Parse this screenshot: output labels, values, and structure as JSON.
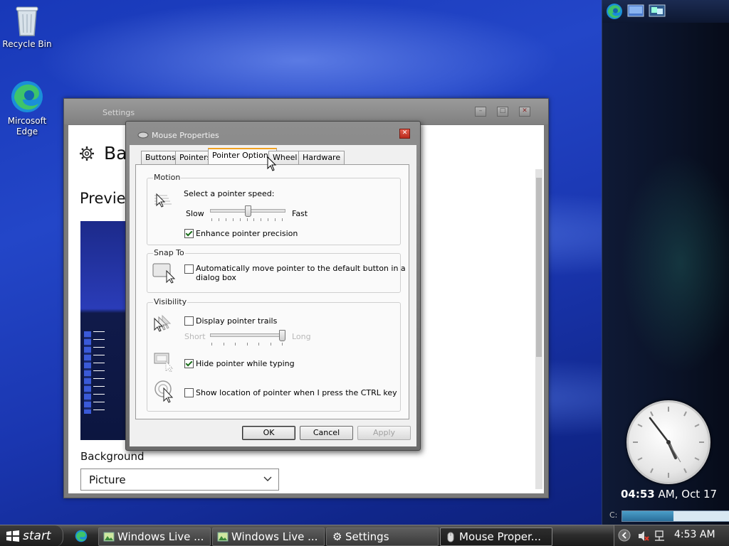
{
  "desktop": {
    "icons": [
      {
        "label": "Recycle Bin"
      },
      {
        "label": "Mircosoft Edge"
      }
    ]
  },
  "settings_window": {
    "title": "Settings",
    "page_heading": "Ba",
    "preview_label": "Previe",
    "background_label": "Background",
    "background_value": "Picture"
  },
  "dialog": {
    "title": "Mouse Properties",
    "tabs": [
      {
        "label": "Buttons"
      },
      {
        "label": "Pointers"
      },
      {
        "label": "Pointer Options",
        "active": true
      },
      {
        "label": "Wheel"
      },
      {
        "label": "Hardware"
      }
    ],
    "motion": {
      "group_label": "Motion",
      "prompt": "Select a pointer speed:",
      "slow": "Slow",
      "fast": "Fast",
      "speed_fraction": 0.5,
      "precision_label": "Enhance pointer precision",
      "precision_checked": true
    },
    "snap_to": {
      "group_label": "Snap To",
      "label_line1": "Automatically move pointer to the default button in a",
      "label_line2": "dialog box",
      "checked": false
    },
    "visibility": {
      "group_label": "Visibility",
      "trails_label": "Display pointer trails",
      "trails_checked": false,
      "short": "Short",
      "long": "Long",
      "trail_fraction": 1.0,
      "hide_label": "Hide pointer while typing",
      "hide_checked": true,
      "ctrl_label": "Show location of pointer when I press the CTRL key",
      "ctrl_checked": false
    },
    "buttons": {
      "ok": "OK",
      "cancel": "Cancel",
      "apply": "Apply"
    }
  },
  "sidebar": {
    "clock_time_bold": "04:53",
    "clock_rest": " AM, Oct 17",
    "drive_label": "C:",
    "drive_fraction": 0.48
  },
  "taskbar": {
    "start": "start",
    "items": [
      {
        "label": "Windows Live ..."
      },
      {
        "label": "Windows Live ..."
      },
      {
        "label": "Settings"
      },
      {
        "label": "Mouse Proper..."
      }
    ],
    "time": "4:53 AM"
  },
  "colors": {
    "accent_tab": "#f0a020",
    "close_red": "#c8372a",
    "desktop_blue": "#1f40c0"
  }
}
